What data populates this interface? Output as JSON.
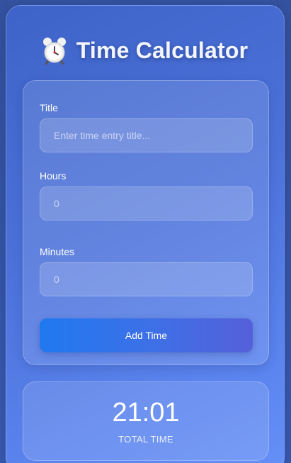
{
  "app": {
    "title": "Time Calculator",
    "icon": "alarm-clock-icon"
  },
  "form": {
    "title_label": "Title",
    "title_placeholder": "Enter time entry title...",
    "title_value": "",
    "hours_label": "Hours",
    "hours_placeholder": "0",
    "hours_value": "",
    "minutes_label": "Minutes",
    "minutes_placeholder": "0",
    "minutes_value": "",
    "add_button_label": "Add Time"
  },
  "total": {
    "value": "21:01",
    "label": "TOTAL TIME"
  },
  "colors": {
    "accent_button_start": "#2079f0",
    "accent_button_end": "#5560da",
    "background": "#3553a0",
    "card_text": "#ffffff"
  }
}
